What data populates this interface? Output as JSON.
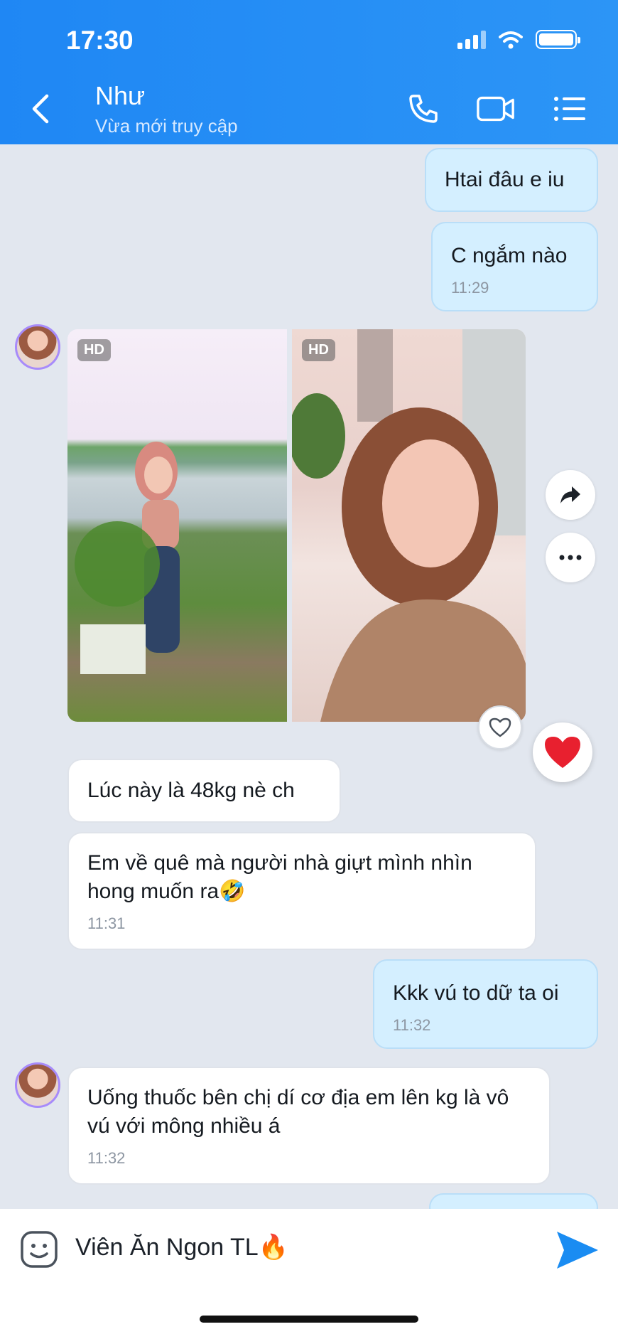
{
  "status_bar": {
    "time": "17:30"
  },
  "header": {
    "contact_name": "Như",
    "contact_status": "Vừa mới truy cập"
  },
  "messages": [
    {
      "dir": "out",
      "text": "Htai đâu e iu"
    },
    {
      "dir": "out",
      "text": "C ngắm nào",
      "time": "11:29"
    },
    {
      "dir": "in",
      "type": "photos",
      "badges": [
        "HD",
        "HD"
      ]
    },
    {
      "dir": "in",
      "text": "Lúc này là 48kg nè ch"
    },
    {
      "dir": "in",
      "text": "Em về quê mà người nhà giựt mình nhìn hong muốn ra🤣",
      "time": "11:31"
    },
    {
      "dir": "out",
      "text": "Kkk vú to dữ ta oi",
      "time": "11:32"
    },
    {
      "dir": "in",
      "text": "Uống thuốc bên chị dí cơ địa em lên kg là vô vú với mông nhiều á",
      "time": "11:32"
    }
  ],
  "reaction": "❤️",
  "input": {
    "value": "Viên Ăn Ngon TL🔥"
  },
  "icons": {
    "back": "chevron-left-icon",
    "call": "phone-icon",
    "video": "video-camera-icon",
    "menu": "list-menu-icon",
    "share": "share-arrow-icon",
    "more": "more-dots-icon",
    "like": "heart-outline-icon",
    "sticker": "sticker-face-icon",
    "send": "send-arrow-icon"
  },
  "colors": {
    "header": "#1f87f4",
    "outgoing_bubble": "#d4efff",
    "incoming_bubble": "#ffffff",
    "background": "#e2e7ef",
    "send": "#1a8cf2"
  }
}
